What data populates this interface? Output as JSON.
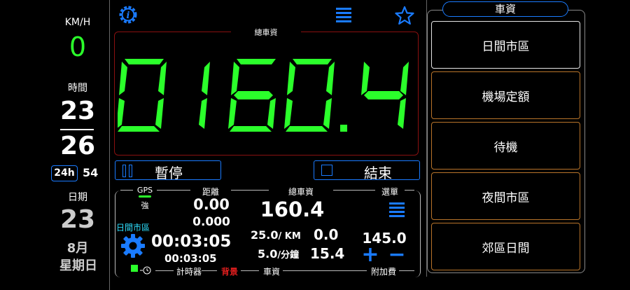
{
  "left": {
    "speed_unit": "KM/H",
    "speed_value": "0",
    "time_label": "時間",
    "hour": "23",
    "minute": "26",
    "mode_24h": "24h",
    "seconds": "54",
    "date_label": "日期",
    "day": "23",
    "month": "8月",
    "weekday": "星期日"
  },
  "top": {
    "meter_label": "總車資",
    "meter_digits": [
      "0",
      "1",
      "6",
      "0",
      "4"
    ],
    "pause_label": "暫停",
    "end_label": "結束"
  },
  "info": {
    "gps_label": "GPS",
    "gps_strength": "強",
    "rate_mode": "日間市區",
    "distance_label": "距離",
    "distance_main": "0.00",
    "distance_sub": "0.000",
    "fare_label": "總車資",
    "fare_value": "160.4",
    "menu_label": "選單",
    "per_km_value": "25.0",
    "per_km_unit": "/ KM",
    "per_km_amount": "0.0",
    "per_min_value": "5.0",
    "per_min_unit": "/分鐘",
    "per_min_amount": "15.4",
    "elapsed_main": "00:03:05",
    "elapsed_sub": "00:03:05",
    "surcharge_value": "145.0",
    "plus_symbol": "+",
    "minus_symbol": "−",
    "bottom_timer": "計時器",
    "bottom_bg": "背景",
    "bottom_fare": "車資",
    "bottom_surcharge": "附加費"
  },
  "sidebar": {
    "title": "車資",
    "items": [
      {
        "label": "日間市區"
      },
      {
        "label": "機場定額"
      },
      {
        "label": "待機"
      },
      {
        "label": "夜間市區"
      },
      {
        "label": "郊區日間"
      }
    ]
  },
  "colors": {
    "green": "#2bff2b",
    "blue": "#1a7bff",
    "red": "#e01e1e",
    "orange": "#b8742a"
  }
}
